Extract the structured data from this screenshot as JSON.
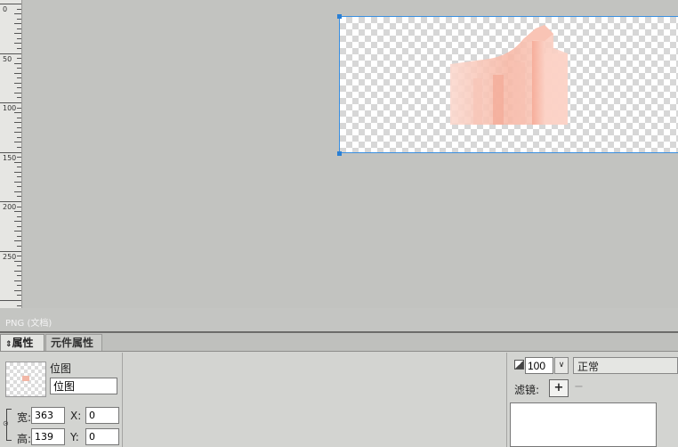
{
  "ruler": {
    "marks": [
      "0",
      "50",
      "100",
      "150",
      "200",
      "250"
    ]
  },
  "status_bar": {
    "document_label": "PNG (文档)"
  },
  "panel": {
    "tabs": [
      {
        "label": "属性",
        "icon": "chevron-updown-icon",
        "active": true
      },
      {
        "label": "元件属性",
        "active": false
      }
    ],
    "object": {
      "type_label": "位图",
      "name_value": "位图"
    },
    "size": {
      "width_label": "宽:",
      "width_value": "363",
      "height_label": "高:",
      "height_value": "139"
    },
    "position": {
      "x_label": "X:",
      "x_value": "0",
      "y_label": "Y:",
      "y_value": "0"
    },
    "appearance": {
      "opacity_value": "100",
      "blend_mode": "正常",
      "filters_label": "滤镜:",
      "add_filter_symbol": "+",
      "remove_filter_symbol": "−"
    }
  },
  "colors": {
    "selection_border": "#3a8fe0",
    "workspace_bg": "#c2c3c0",
    "panel_bg": "#d3d4d1",
    "bitmap_tint": "#f6b3a1"
  }
}
